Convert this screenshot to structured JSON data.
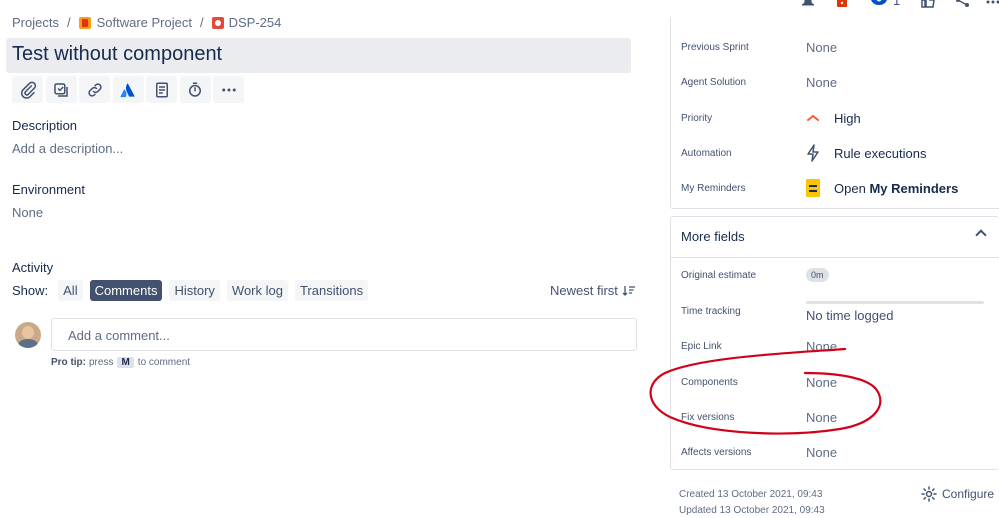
{
  "breadcrumb": {
    "projects": "Projects",
    "separator": "/",
    "project": "Software Project",
    "issue_key": "DSP-254"
  },
  "issue": {
    "title": "Test without component"
  },
  "toolbar": {
    "icons": [
      "attachment-icon",
      "subtask-icon",
      "link-icon",
      "atlassian-icon",
      "document-icon",
      "stopwatch-icon",
      "more-icon"
    ]
  },
  "description": {
    "label": "Description",
    "placeholder": "Add a description..."
  },
  "environment": {
    "label": "Environment",
    "value": "None"
  },
  "activity": {
    "label": "Activity",
    "show_label": "Show:",
    "tabs": [
      "All",
      "Comments",
      "History",
      "Work log",
      "Transitions"
    ],
    "active_tab": "Comments",
    "sort_label": "Newest first",
    "comment_placeholder": "Add a comment...",
    "pro_tip_bold": "Pro tip:",
    "pro_tip_text1": "press",
    "pro_tip_key": "M",
    "pro_tip_text2": "to comment"
  },
  "header_actions": {
    "watch_count": "1"
  },
  "details": [
    {
      "label": "Previous Sprint",
      "value": "None"
    },
    {
      "label": "Agent Solution",
      "value": "None"
    },
    {
      "label": "Priority",
      "value": "High"
    },
    {
      "label": "Automation",
      "value": "Rule executions"
    },
    {
      "label": "My Reminders",
      "value_prefix": "Open",
      "value_bold": "My Reminders"
    }
  ],
  "more_fields": {
    "header": "More fields",
    "rows": [
      {
        "label": "Original estimate",
        "value": "0m"
      },
      {
        "label": "Time tracking",
        "value": "No time logged"
      },
      {
        "label": "Epic Link",
        "value": "None"
      },
      {
        "label": "Components",
        "value": "None"
      },
      {
        "label": "Fix versions",
        "value": "None"
      },
      {
        "label": "Affects versions",
        "value": "None"
      }
    ]
  },
  "footer": {
    "created": "Created 13 October 2021, 09:43",
    "updated": "Updated 13 October 2021, 09:43",
    "configure": "Configure"
  },
  "colors": {
    "priority_high": "#ff5630",
    "annotation_red": "#d0021b",
    "active_tab_bg": "#42526e"
  }
}
